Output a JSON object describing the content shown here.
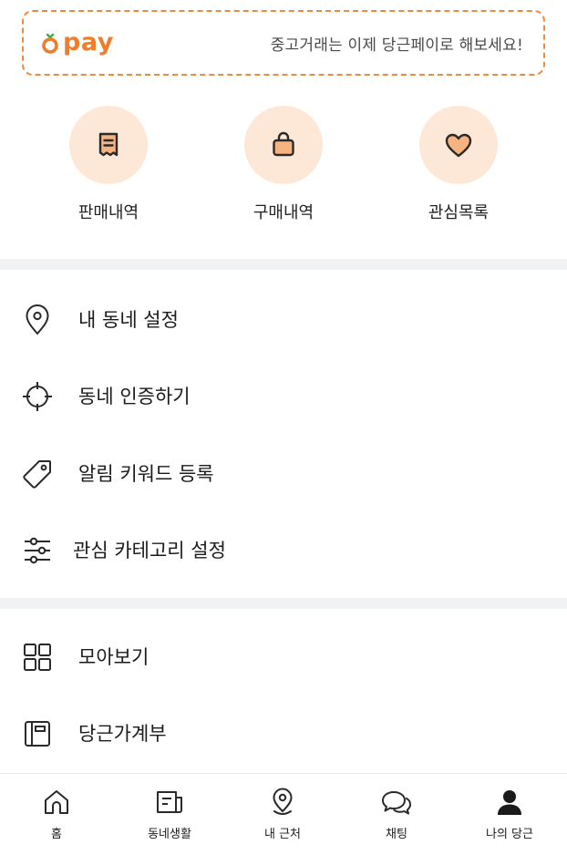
{
  "pay_banner": {
    "logo_text": "pay",
    "promo_text": "중고거래는 이제 당근페이로 해보세요!"
  },
  "quick_actions": [
    {
      "label": "판매내역",
      "icon": "receipt-icon"
    },
    {
      "label": "구매내역",
      "icon": "shopping-bag-icon"
    },
    {
      "label": "관심목록",
      "icon": "heart-icon"
    }
  ],
  "menu": {
    "section1": [
      {
        "label": "내 동네 설정",
        "icon": "location-pin-icon"
      },
      {
        "label": "동네 인증하기",
        "icon": "crosshair-icon"
      },
      {
        "label": "알림 키워드 등록",
        "icon": "tag-icon"
      },
      {
        "label": "관심 카테고리 설정",
        "icon": "sliders-icon"
      }
    ],
    "section2": [
      {
        "label": "모아보기",
        "icon": "grid-icon"
      },
      {
        "label": "당근가계부",
        "icon": "notebook-icon"
      }
    ]
  },
  "bottom_nav": [
    {
      "label": "홈",
      "icon": "home-icon"
    },
    {
      "label": "동네생활",
      "icon": "newspaper-icon"
    },
    {
      "label": "내 근처",
      "icon": "location-pin-icon"
    },
    {
      "label": "채팅",
      "icon": "chat-bubbles-icon"
    },
    {
      "label": "나의 당근",
      "icon": "user-icon",
      "active": true
    }
  ],
  "colors": {
    "accent": "#ee7d2c",
    "icon_circle_bg": "#fde8d8",
    "divider": "#f1f2f4",
    "text": "#1b1b1b"
  }
}
